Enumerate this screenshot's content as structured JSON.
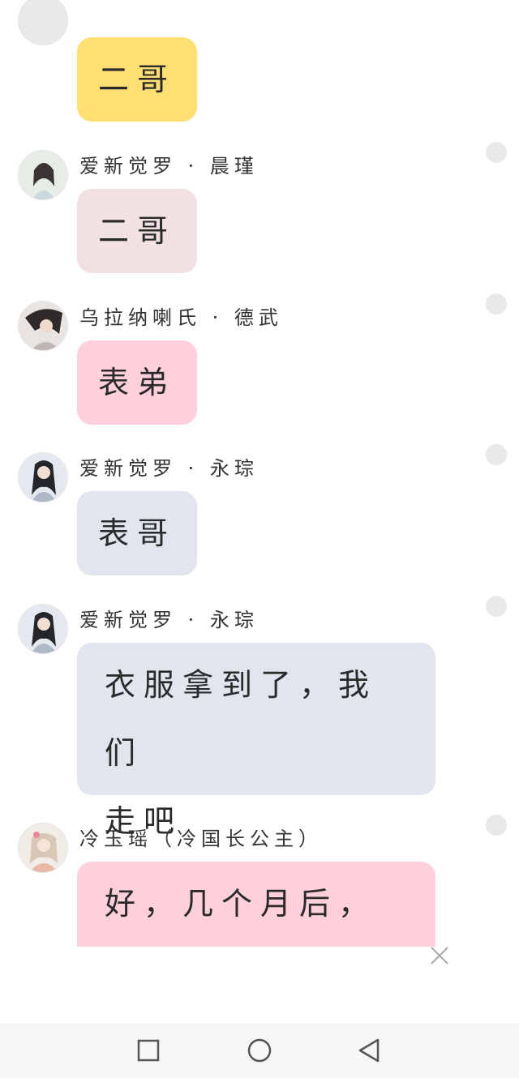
{
  "colors": {
    "yellow": "#ffdf73",
    "blush": "#f1e1e3",
    "pink": "#fdd0dc",
    "bluegray": "#e0e5ee"
  },
  "messages": [
    {
      "sender": "",
      "text": "二哥",
      "bubble_color": "#ffdf73",
      "avatar_icon": "anime-avatar-icon"
    },
    {
      "sender": "爱新觉罗 · 晨瑾",
      "text": "二哥",
      "bubble_color": "#f1e1e3",
      "avatar_icon": "anime-avatar-icon"
    },
    {
      "sender": "乌拉纳喇氏 · 德武",
      "text": "表弟",
      "bubble_color": "#fdd0dc",
      "avatar_icon": "anime-avatar-icon"
    },
    {
      "sender": "爱新觉罗 · 永琮",
      "text": "表哥",
      "bubble_color": "#e0e5ee",
      "avatar_icon": "anime-avatar-icon"
    },
    {
      "sender": "爱新觉罗 · 永琮",
      "text_line1": "衣服拿到了，我们",
      "text_line2": "走吧",
      "bubble_color": "#e0e5ee",
      "avatar_icon": "anime-avatar-icon"
    },
    {
      "sender": "冷玉瑶（冷国长公主）",
      "text_line1": "好，几个月后，再",
      "bubble_color": "#fdd0dc",
      "avatar_icon": "anime-avatar-icon"
    }
  ],
  "controls": {
    "close_icon": "close-icon",
    "nav": [
      "recent-apps-icon",
      "home-icon",
      "back-icon"
    ]
  }
}
